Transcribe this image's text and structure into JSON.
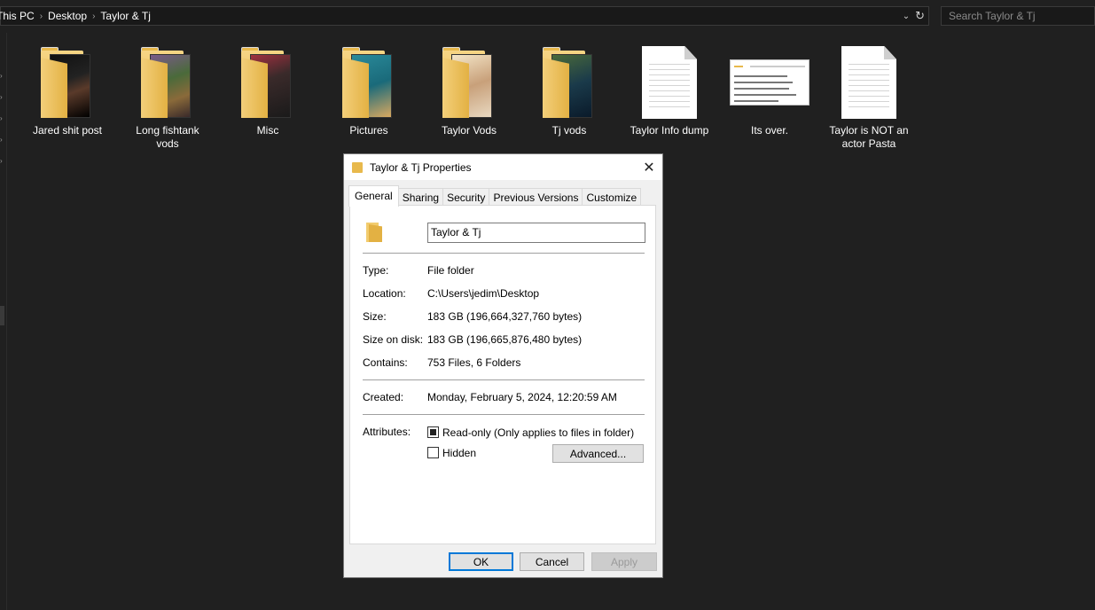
{
  "breadcrumb": {
    "items": [
      "This PC",
      "Desktop",
      "Taylor & Tj"
    ]
  },
  "search": {
    "placeholder": "Search Taylor & Tj"
  },
  "items": [
    {
      "label": "Jared shit post",
      "type": "folder"
    },
    {
      "label": "Long fishtank vods",
      "type": "folder"
    },
    {
      "label": "Misc",
      "type": "folder"
    },
    {
      "label": "Pictures",
      "type": "folder"
    },
    {
      "label": "Taylor Vods",
      "type": "folder"
    },
    {
      "label": "Tj vods",
      "type": "folder"
    },
    {
      "label": "Taylor Info dump",
      "type": "document"
    },
    {
      "label": "Its over.",
      "type": "image"
    },
    {
      "label": "Taylor is NOT an actor Pasta",
      "type": "document"
    }
  ],
  "dialog": {
    "title": "Taylor & Tj Properties",
    "tabs": [
      "General",
      "Sharing",
      "Security",
      "Previous Versions",
      "Customize"
    ],
    "name_value": "Taylor & Tj",
    "type_label": "Type:",
    "type_value": "File folder",
    "location_label": "Location:",
    "location_value": "C:\\Users\\jedim\\Desktop",
    "size_label": "Size:",
    "size_value": "183 GB (196,664,327,760 bytes)",
    "size_on_disk_label": "Size on disk:",
    "size_on_disk_value": "183 GB (196,665,876,480 bytes)",
    "contains_label": "Contains:",
    "contains_value": "753 Files, 6 Folders",
    "created_label": "Created:",
    "created_value": "Monday, February 5, 2024, 12:20:59 AM",
    "attributes_label": "Attributes:",
    "readonly_label": "Read-only (Only applies to files in folder)",
    "readonly_state": "indeterminate",
    "hidden_label": "Hidden",
    "hidden_state": "unchecked",
    "advanced_label": "Advanced...",
    "ok_label": "OK",
    "cancel_label": "Cancel",
    "apply_label": "Apply"
  },
  "colors": {
    "accent": "#0078d7",
    "folder": "#e8b94c",
    "background": "#202020"
  }
}
